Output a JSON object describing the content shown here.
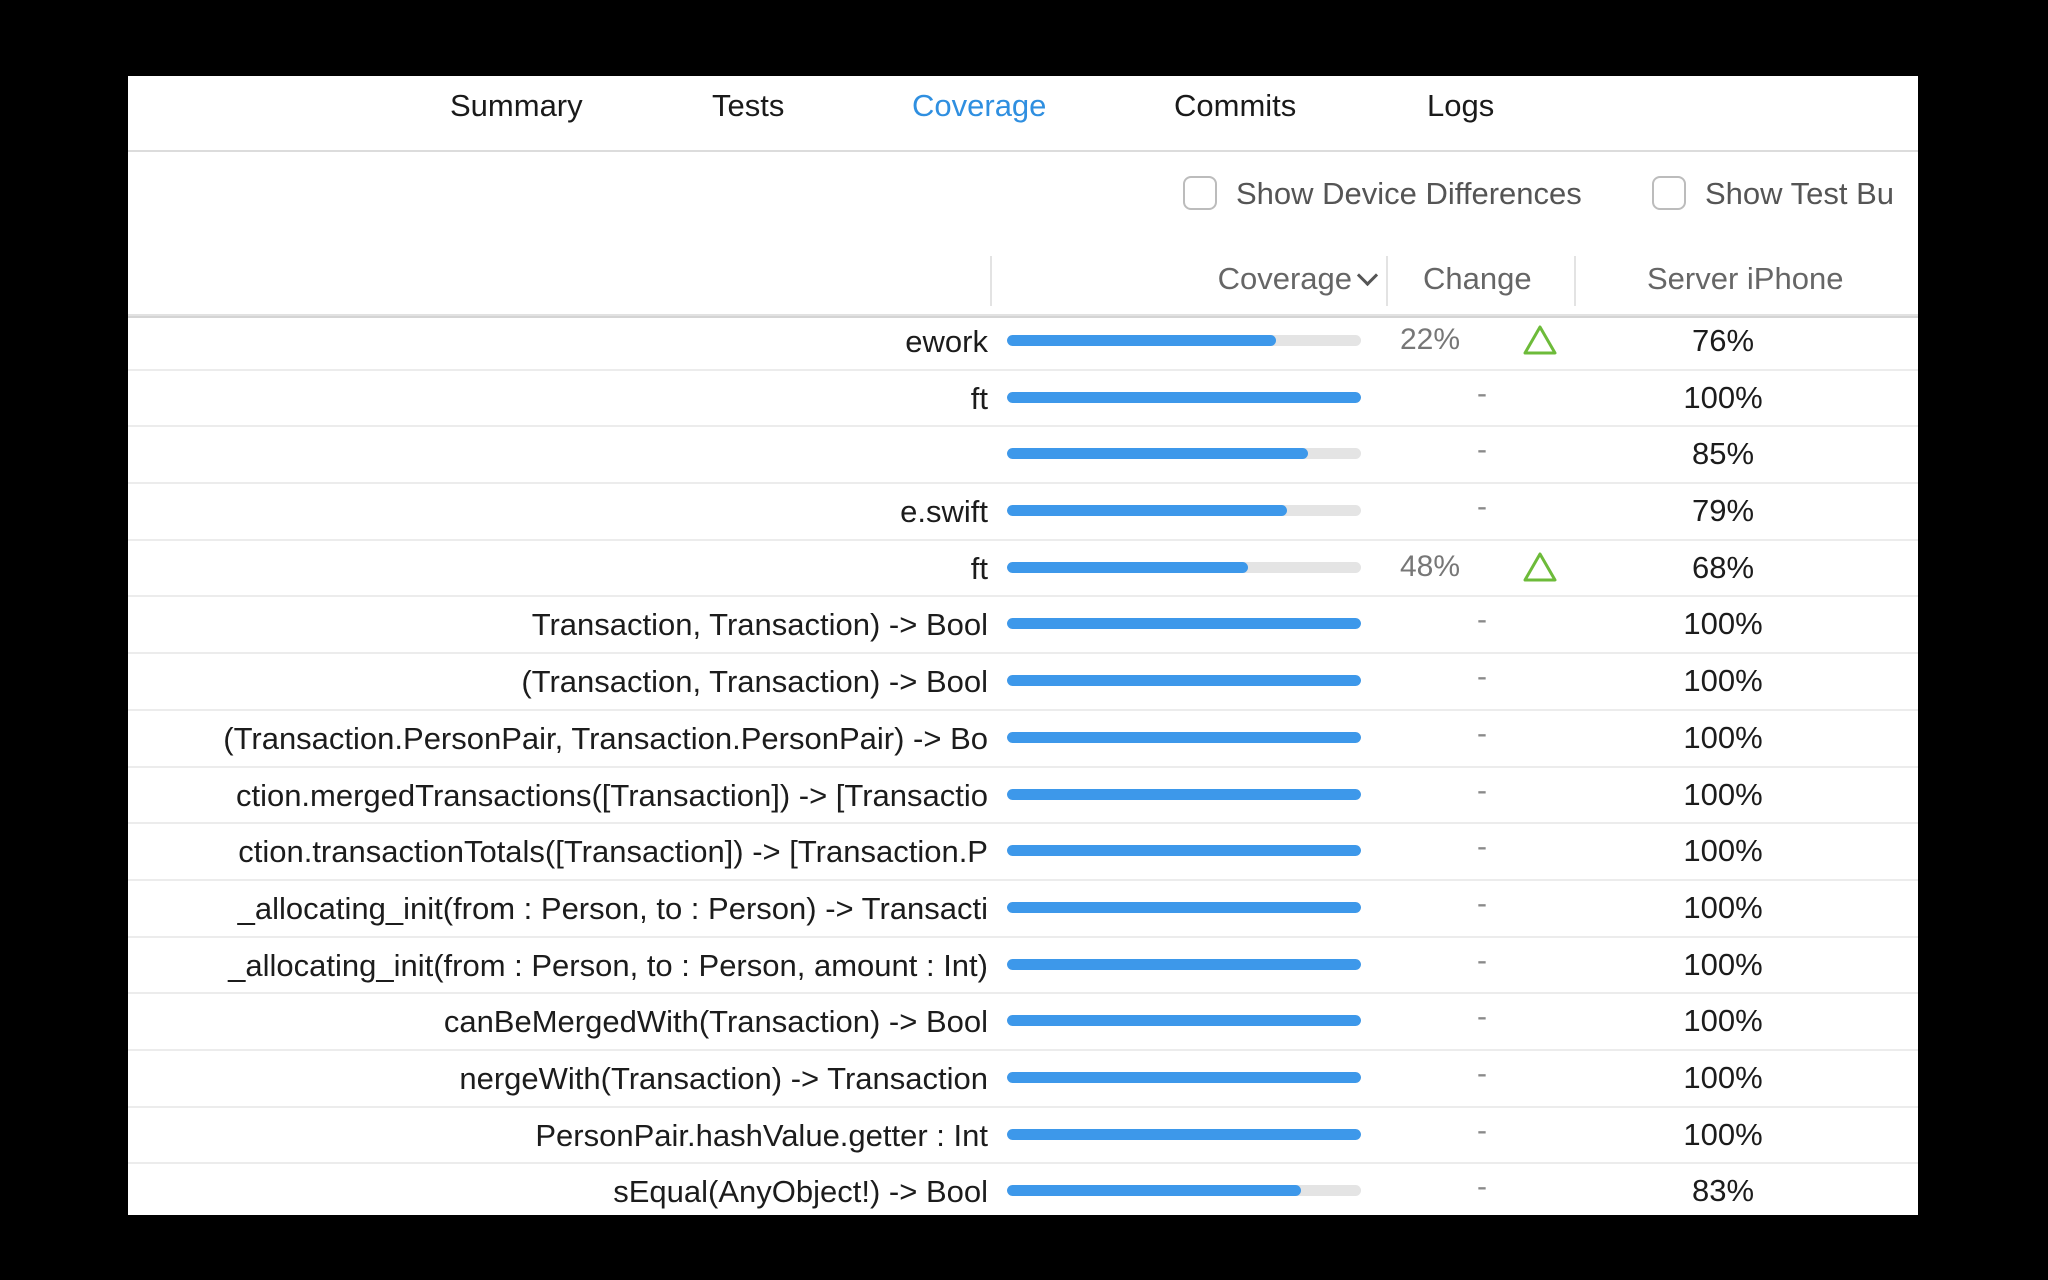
{
  "tabs": [
    {
      "label": "Summary",
      "active": false
    },
    {
      "label": "Tests",
      "active": false
    },
    {
      "label": "Coverage",
      "active": true
    },
    {
      "label": "Commits",
      "active": false
    },
    {
      "label": "Logs",
      "active": false
    }
  ],
  "toolbar": {
    "show_device_differences": {
      "label": "Show Device Differences",
      "checked": false
    },
    "show_test_bundles": {
      "label": "Show Test Bu",
      "checked": false
    }
  },
  "columns": {
    "coverage": "Coverage",
    "change": "Change",
    "device": "Server iPhone"
  },
  "colors": {
    "accent": "#2f8fe0",
    "bar_fill": "#3d98ea",
    "bar_track": "#e4e4e4",
    "increase_icon": "#6dbb3a"
  },
  "rows": [
    {
      "name": "ework",
      "coverage": 0.76,
      "change": "22%",
      "change_icon": "triangle-up-icon",
      "pct": "76%"
    },
    {
      "name": "ft",
      "coverage": 1.0,
      "change": "-",
      "pct": "100%"
    },
    {
      "name": "",
      "coverage": 0.85,
      "change": "-",
      "pct": "85%"
    },
    {
      "name": "e.swift",
      "coverage": 0.79,
      "change": "-",
      "pct": "79%"
    },
    {
      "name": "ft",
      "coverage": 0.68,
      "change": "48%",
      "change_icon": "triangle-up-icon",
      "pct": "68%"
    },
    {
      "name": "Transaction, Transaction) -> Bool",
      "coverage": 1.0,
      "change": "-",
      "pct": "100%"
    },
    {
      "name": "(Transaction, Transaction) -> Bool",
      "coverage": 1.0,
      "change": "-",
      "pct": "100%"
    },
    {
      "name": "(Transaction.PersonPair, Transaction.PersonPair) -> Bo",
      "coverage": 1.0,
      "change": "-",
      "pct": "100%"
    },
    {
      "name": "ction.mergedTransactions([Transaction]) -> [Transactio",
      "coverage": 1.0,
      "change": "-",
      "pct": "100%"
    },
    {
      "name": "ction.transactionTotals([Transaction]) -> [Transaction.P",
      "coverage": 1.0,
      "change": "-",
      "pct": "100%"
    },
    {
      "name": "_allocating_init(from : Person, to : Person) -> Transacti",
      "coverage": 1.0,
      "change": "-",
      "pct": "100%"
    },
    {
      "name": "_allocating_init(from : Person, to : Person, amount : Int)",
      "coverage": 1.0,
      "change": "-",
      "pct": "100%"
    },
    {
      "name": "canBeMergedWith(Transaction) -> Bool",
      "coverage": 1.0,
      "change": "-",
      "pct": "100%"
    },
    {
      "name": "nergeWith(Transaction) -> Transaction",
      "coverage": 1.0,
      "change": "-",
      "pct": "100%"
    },
    {
      "name": "PersonPair.hashValue.getter : Int",
      "coverage": 1.0,
      "change": "-",
      "pct": "100%"
    },
    {
      "name": "sEqual(AnyObject!) -> Bool",
      "coverage": 0.83,
      "change": "-",
      "pct": "83%"
    }
  ]
}
